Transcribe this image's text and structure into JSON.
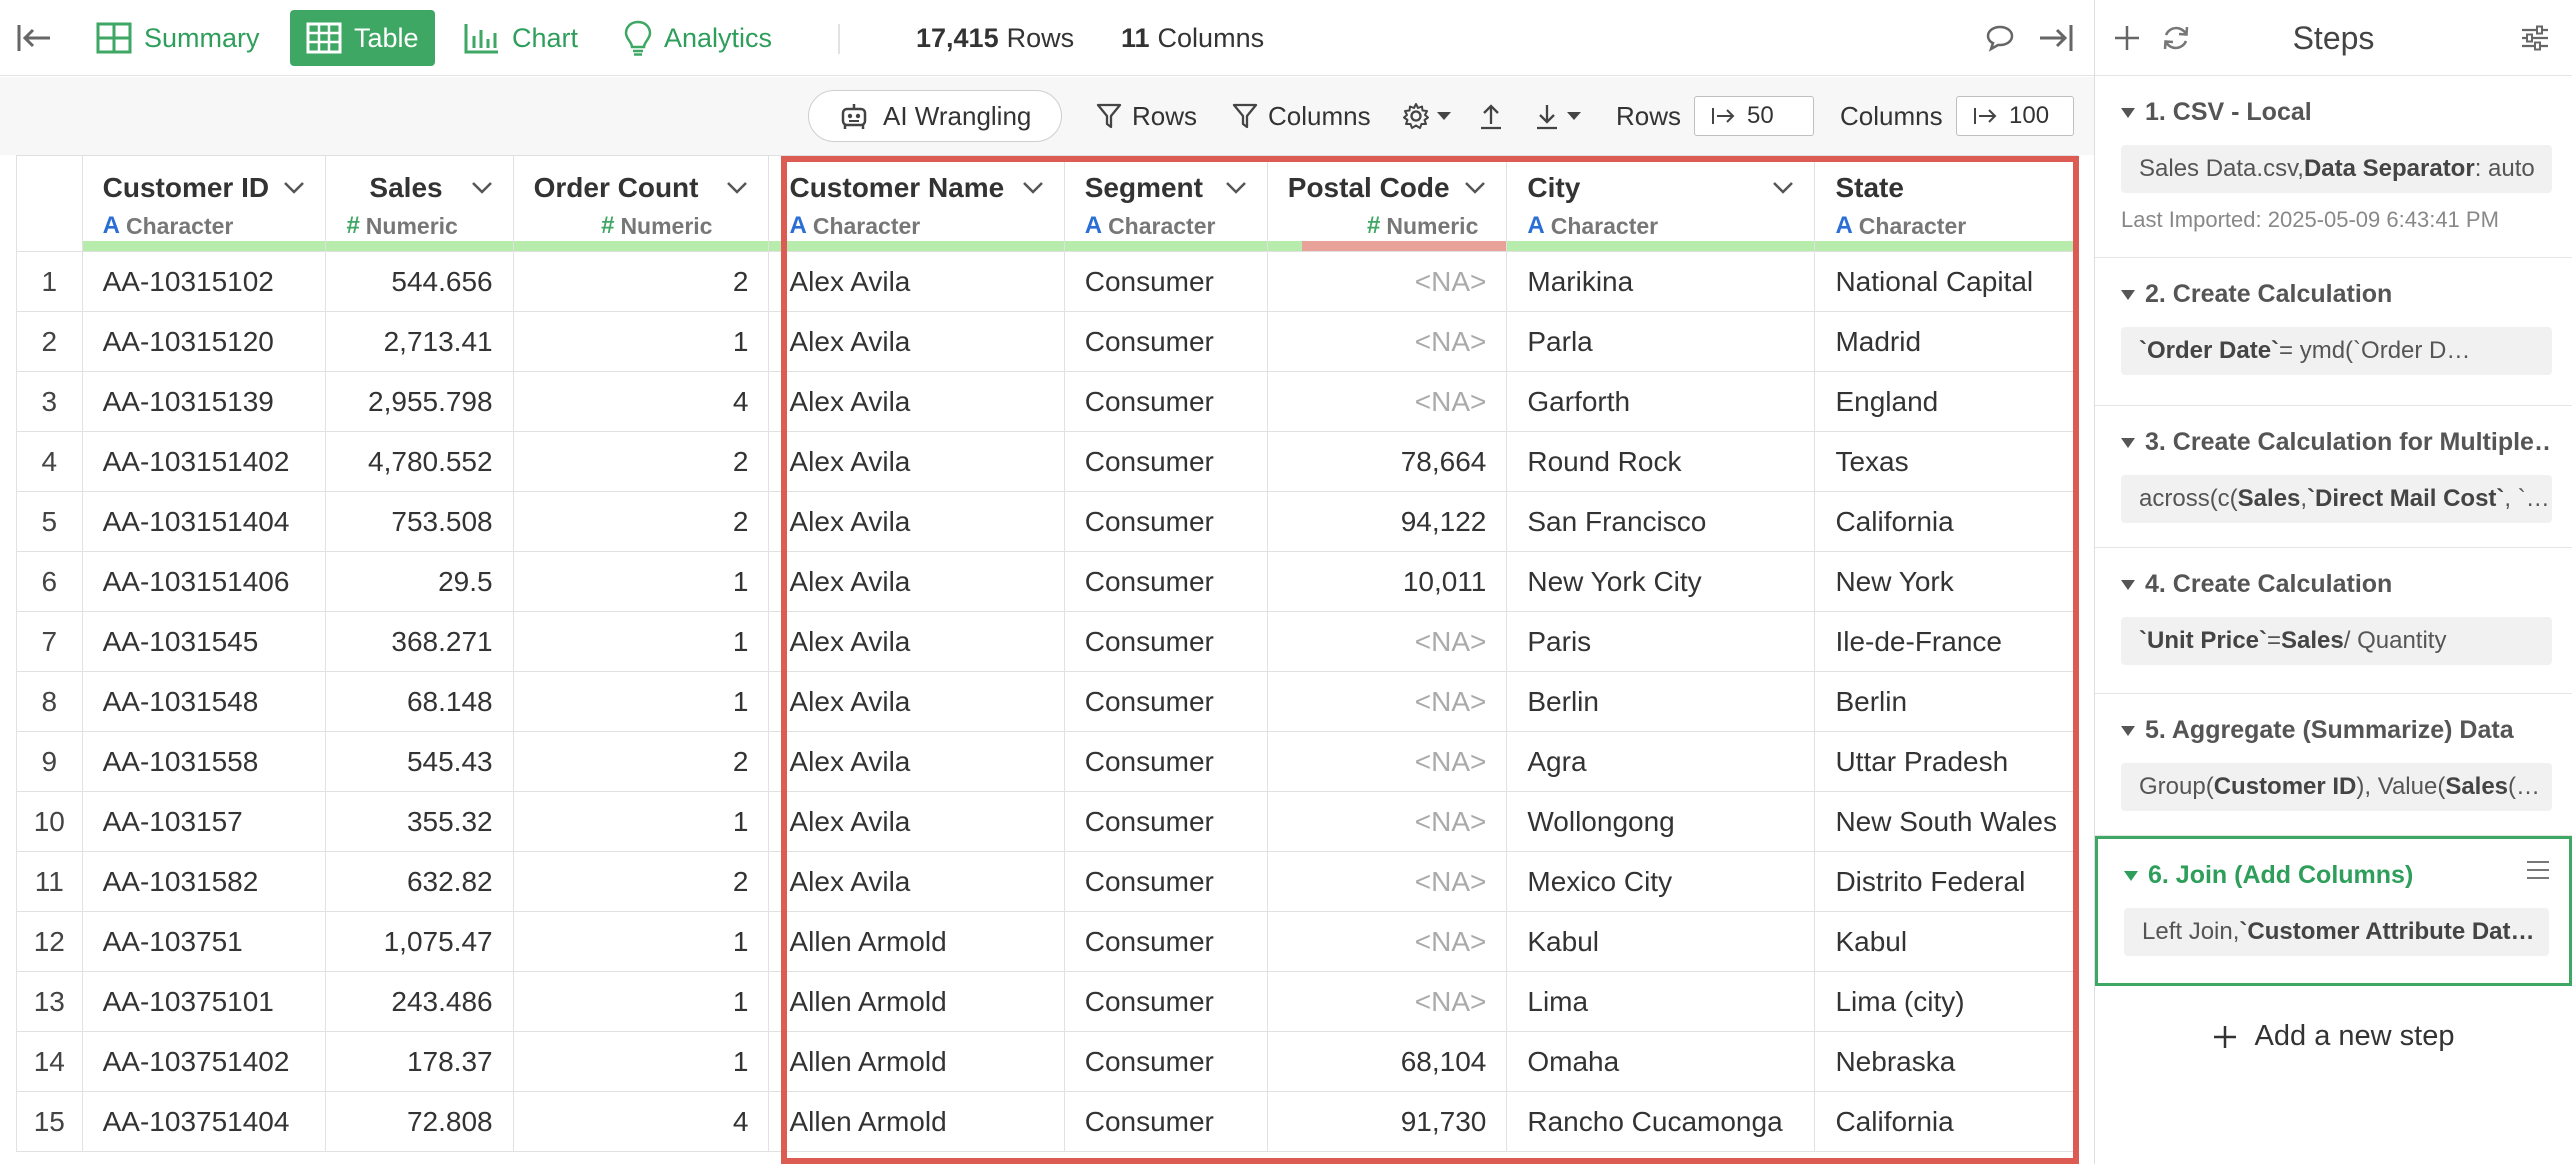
{
  "topbar": {
    "tabs": [
      {
        "label": "Summary",
        "icon": "summary-grid-icon"
      },
      {
        "label": "Table",
        "icon": "table-icon"
      },
      {
        "label": "Chart",
        "icon": "bar-chart-icon"
      },
      {
        "label": "Analytics",
        "icon": "lightbulb-icon"
      }
    ],
    "row_count": "17,415",
    "row_label": "Rows",
    "col_count": "11",
    "col_label": "Columns"
  },
  "toolbar": {
    "ai_label": "AI Wrangling",
    "rows_filter": "Rows",
    "columns_filter": "Columns",
    "rows_label": "Rows",
    "rows_step": "50",
    "columns_label": "Columns",
    "columns_step": "100"
  },
  "table": {
    "columns": [
      {
        "name": "Customer ID",
        "type": "Character"
      },
      {
        "name": "Sales",
        "type": "Numeric"
      },
      {
        "name": "Order Count",
        "type": "Numeric"
      },
      {
        "name": "Customer Name",
        "type": "Character"
      },
      {
        "name": "Segment",
        "type": "Character"
      },
      {
        "name": "Postal Code",
        "type": "Numeric"
      },
      {
        "name": "City",
        "type": "Character"
      },
      {
        "name": "State",
        "type": "Character"
      }
    ],
    "na_text": "<NA>",
    "rows": [
      [
        "1",
        "AA-10315102",
        "544.656",
        "2",
        "Alex Avila",
        "Consumer",
        null,
        "Marikina",
        "National Capital"
      ],
      [
        "2",
        "AA-10315120",
        "2,713.41",
        "1",
        "Alex Avila",
        "Consumer",
        null,
        "Parla",
        "Madrid"
      ],
      [
        "3",
        "AA-10315139",
        "2,955.798",
        "4",
        "Alex Avila",
        "Consumer",
        null,
        "Garforth",
        "England"
      ],
      [
        "4",
        "AA-103151402",
        "4,780.552",
        "2",
        "Alex Avila",
        "Consumer",
        "78,664",
        "Round Rock",
        "Texas"
      ],
      [
        "5",
        "AA-103151404",
        "753.508",
        "2",
        "Alex Avila",
        "Consumer",
        "94,122",
        "San Francisco",
        "California"
      ],
      [
        "6",
        "AA-103151406",
        "29.5",
        "1",
        "Alex Avila",
        "Consumer",
        "10,011",
        "New York City",
        "New York"
      ],
      [
        "7",
        "AA-1031545",
        "368.271",
        "1",
        "Alex Avila",
        "Consumer",
        null,
        "Paris",
        "Ile-de-France"
      ],
      [
        "8",
        "AA-1031548",
        "68.148",
        "1",
        "Alex Avila",
        "Consumer",
        null,
        "Berlin",
        "Berlin"
      ],
      [
        "9",
        "AA-1031558",
        "545.43",
        "2",
        "Alex Avila",
        "Consumer",
        null,
        "Agra",
        "Uttar Pradesh"
      ],
      [
        "10",
        "AA-103157",
        "355.32",
        "1",
        "Alex Avila",
        "Consumer",
        null,
        "Wollongong",
        "New South Wales"
      ],
      [
        "11",
        "AA-1031582",
        "632.82",
        "2",
        "Alex Avila",
        "Consumer",
        null,
        "Mexico City",
        "Distrito Federal"
      ],
      [
        "12",
        "AA-103751",
        "1,075.47",
        "1",
        "Allen Armold",
        "Consumer",
        null,
        "Kabul",
        "Kabul"
      ],
      [
        "13",
        "AA-10375101",
        "243.486",
        "1",
        "Allen Armold",
        "Consumer",
        null,
        "Lima",
        "Lima (city)"
      ],
      [
        "14",
        "AA-103751402",
        "178.37",
        "1",
        "Allen Armold",
        "Consumer",
        "68,104",
        "Omaha",
        "Nebraska"
      ],
      [
        "15",
        "AA-103751404",
        "72.808",
        "4",
        "Allen Armold",
        "Consumer",
        "91,730",
        "Rancho Cucamonga",
        "California"
      ]
    ]
  },
  "steps_panel": {
    "title": "Steps",
    "add_label": "Add a new step",
    "steps": [
      {
        "title": "1. CSV - Local",
        "body_html": "Sales Data.csv, <b>Data Separator</b>: auto",
        "meta": "Last Imported: 2025-05-09 6:43:41 PM"
      },
      {
        "title": "2. Create Calculation",
        "body_html": "<b>`Order Date`</b> = ymd(`Order D…"
      },
      {
        "title": "3. Create Calculation for Multiple…",
        "body_html": "across(c(<b>Sales</b>, <b>`Direct Mail Cost`</b>, `…"
      },
      {
        "title": "4. Create Calculation",
        "body_html": "<b>`Unit Price`</b> = <b>Sales</b> / Quantity"
      },
      {
        "title": "5. Aggregate (Summarize) Data",
        "body_html": "Group(<b>Customer ID</b>), Value(<b>Sales</b> (…"
      },
      {
        "title": "6. Join (Add Columns)",
        "body_html": "Left Join, <b>`Customer Attribute Dat…</b>",
        "active": true
      }
    ]
  }
}
